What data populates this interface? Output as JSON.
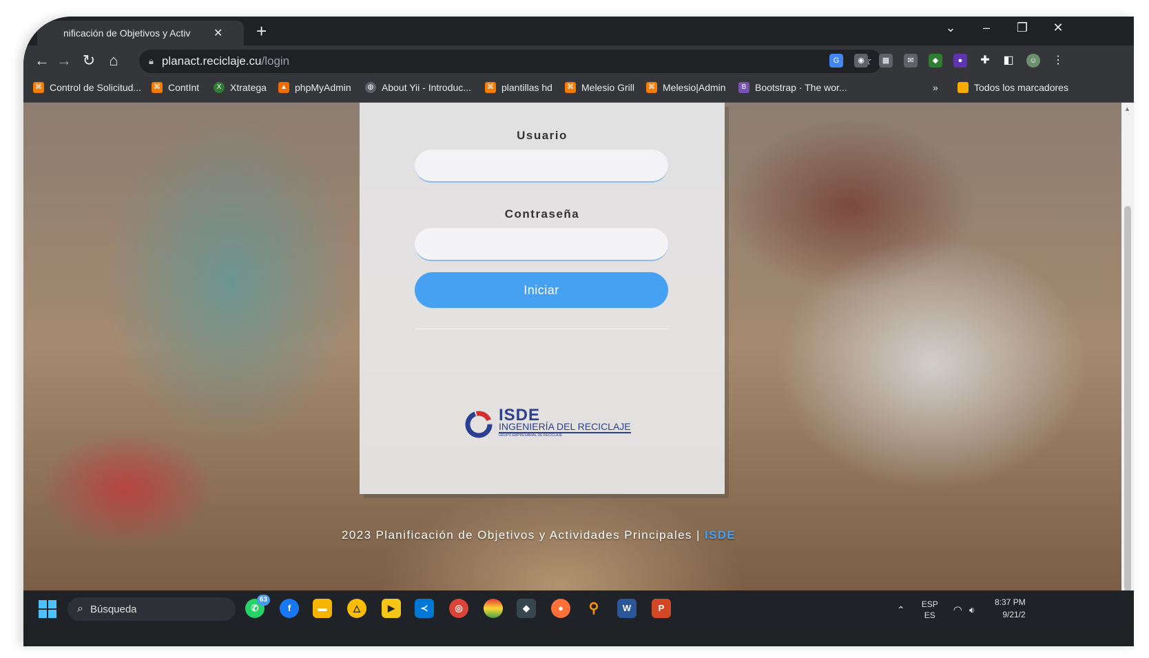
{
  "browser": {
    "tab_title": "nificación de Objetivos y Activ",
    "tab_close": "✕",
    "new_tab": "+",
    "url_host": "planact.reciclaje.cu",
    "url_path": "/login",
    "bookmarks": [
      {
        "label": "Control de Solicitud...",
        "icon": "orange-bookmark-icon"
      },
      {
        "label": "ContInt",
        "icon": "orange-bookmark-icon"
      },
      {
        "label": "Xtratega",
        "icon": "xtratega-icon"
      },
      {
        "label": "phpMyAdmin",
        "icon": "phpmyadmin-icon"
      },
      {
        "label": "About Yii - Introduc...",
        "icon": "globe-icon"
      },
      {
        "label": "plantillas hd",
        "icon": "orange-bookmark-icon"
      },
      {
        "label": "Melesio Grill",
        "icon": "orange-bookmark-icon"
      },
      {
        "label": "Melesio|Admin",
        "icon": "orange-bookmark-icon"
      },
      {
        "label": "Bootstrap · The wor...",
        "icon": "bootstrap-icon"
      }
    ],
    "more_bookmarks": "»",
    "all_bookmarks": "Todos los marcadores"
  },
  "login": {
    "username_label": "Usuario",
    "password_label": "Contraseña",
    "submit_label": "Iniciar",
    "logo_title": "ISDE",
    "logo_subtitle": "INGENIERÍA DEL RECICLAJE",
    "logo_tagline": "GRUPO EMPRESARIAL DE RECICLAJE"
  },
  "footer": {
    "text": "2023 Planificación de Objetivos y Actividades Principales | ",
    "brand": "ISDE"
  },
  "taskbar": {
    "search_label": "Búsqueda",
    "whatsapp_badge": "63",
    "language_top": "ESP",
    "language_bottom": "ES",
    "time": "8:37 PM",
    "date": "9/21/2"
  },
  "colors": {
    "accent": "#46a1f3",
    "logo_blue": "#2b3f8f",
    "chrome_dark": "#202124",
    "chrome_toolbar": "#35363a"
  }
}
